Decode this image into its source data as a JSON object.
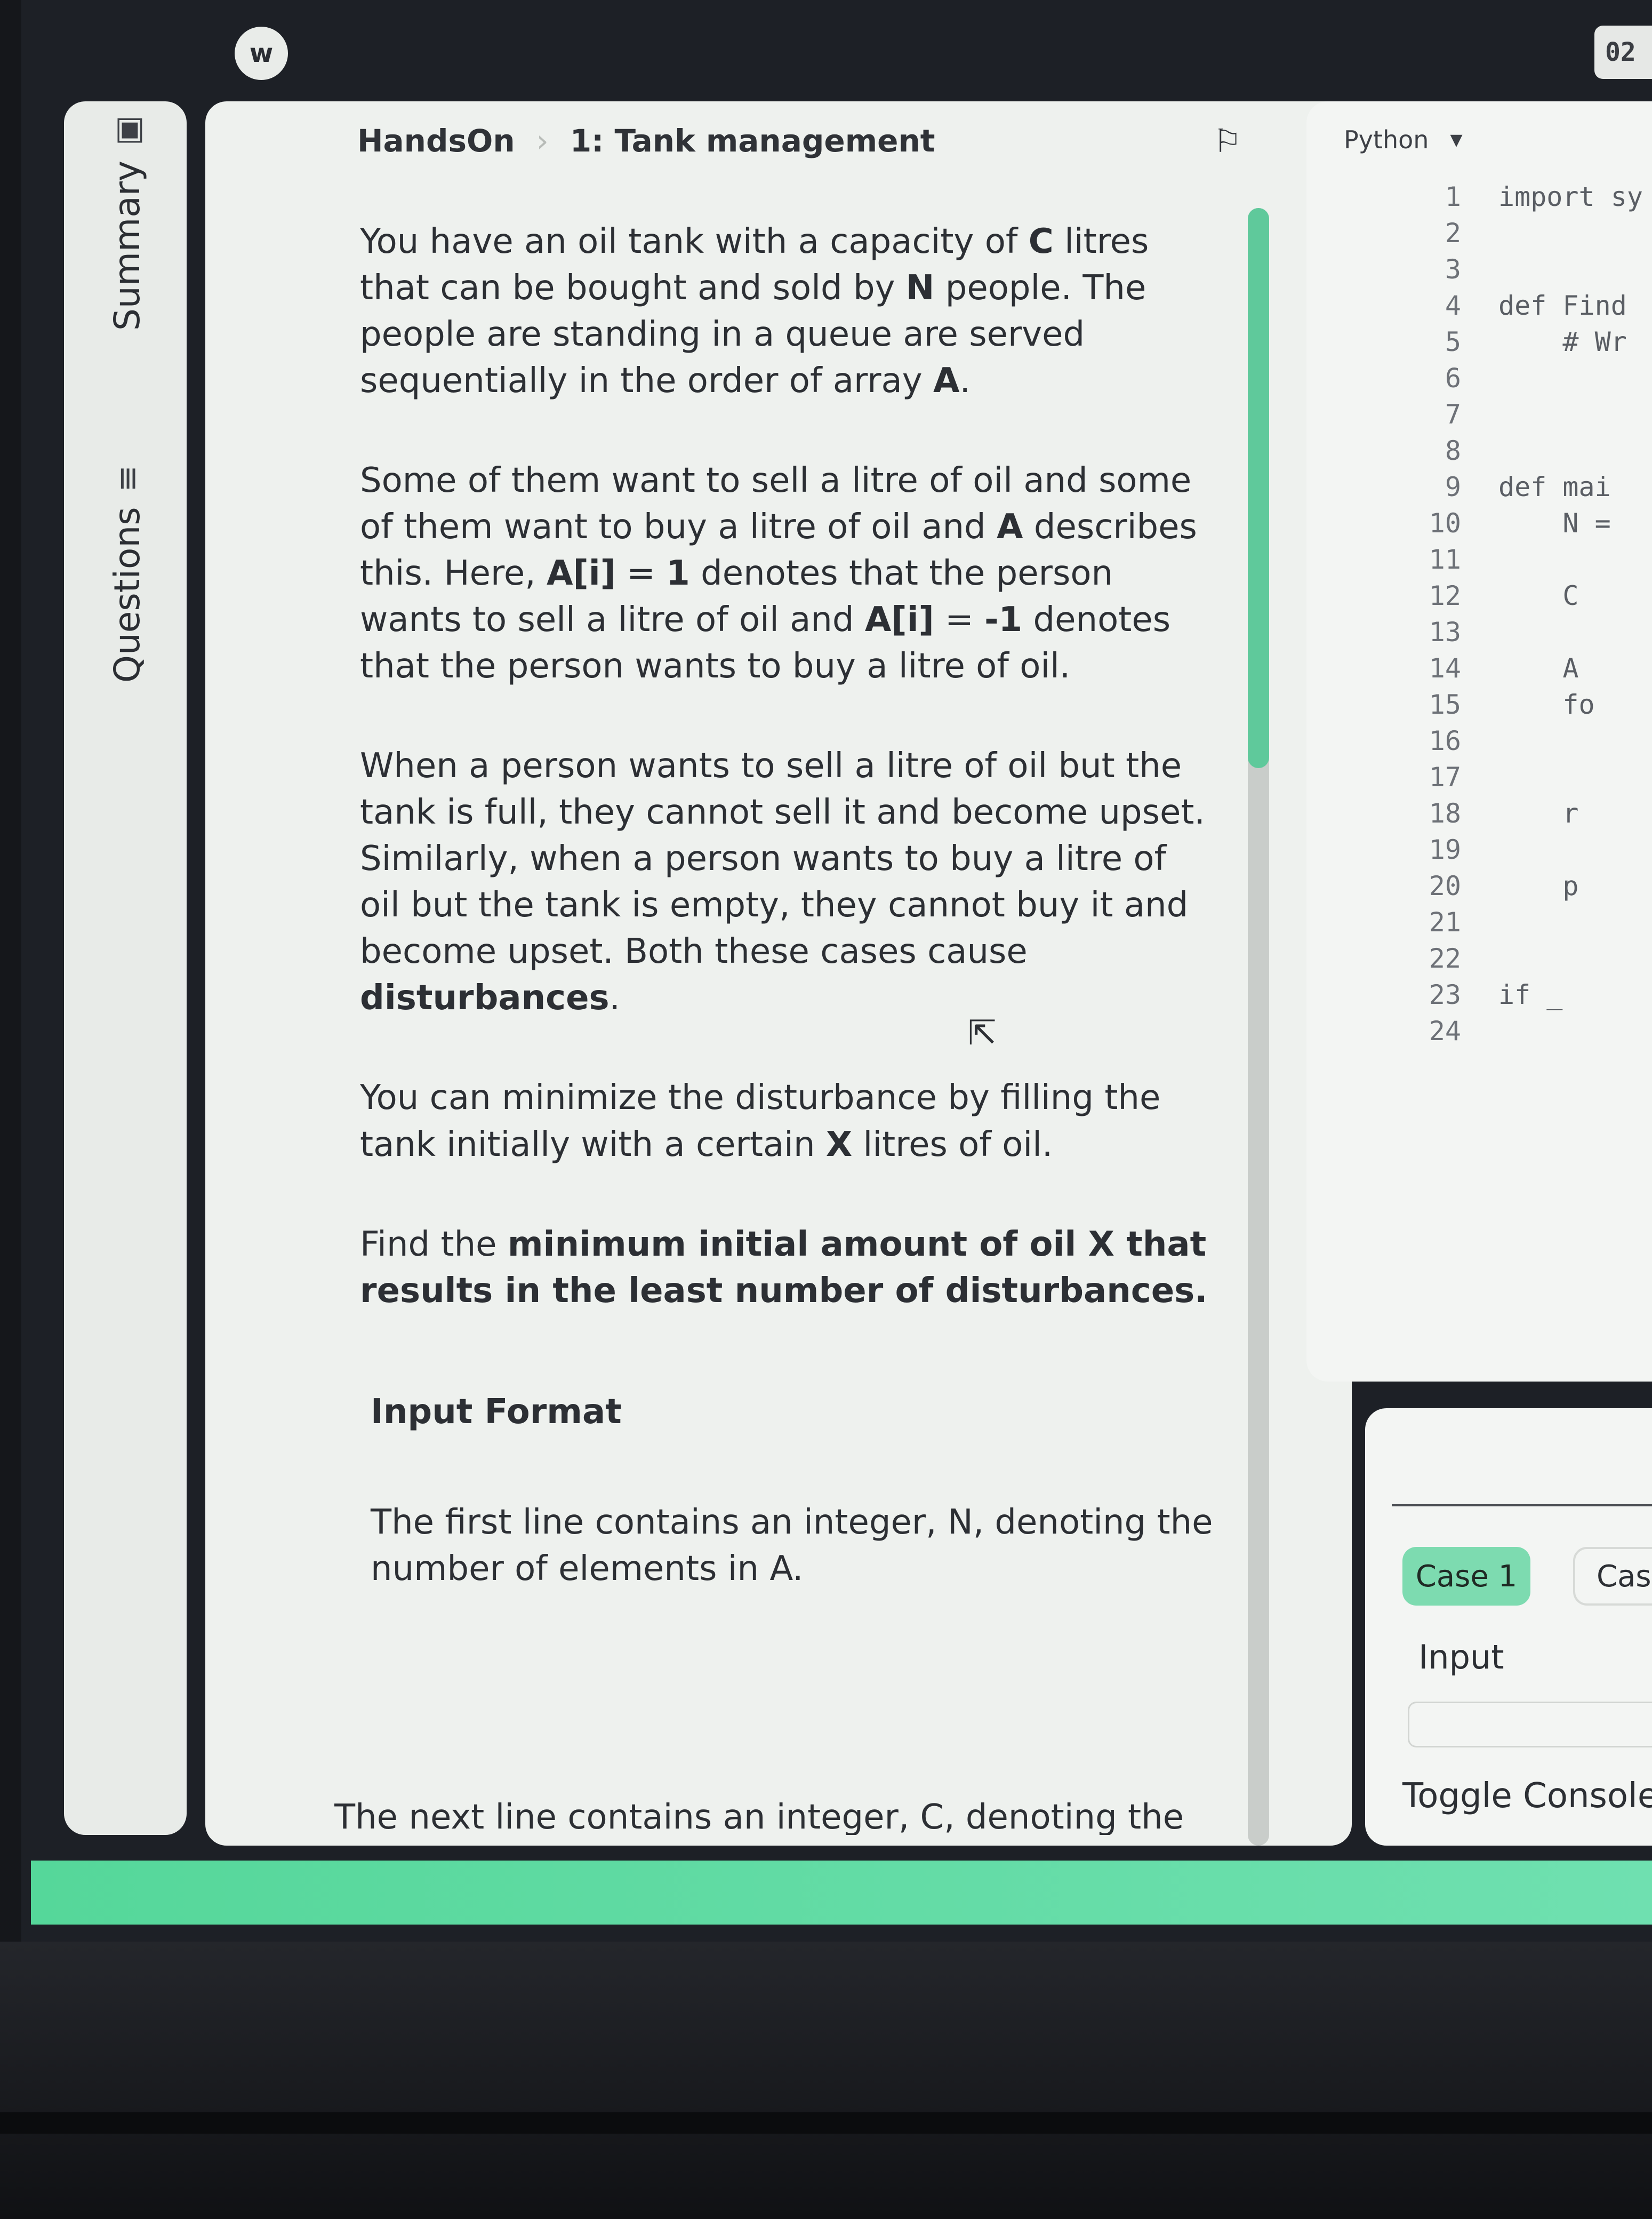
{
  "header": {
    "logo_glyph": "w",
    "timer": "02"
  },
  "sidebar": {
    "summary": {
      "label": "Summary",
      "icon": "bookmark-icon"
    },
    "questions": {
      "label": "Questions",
      "icon": "list-icon"
    }
  },
  "breadcrumb": {
    "root": "HandsOn",
    "current": "1: Tank management"
  },
  "question": {
    "p1_a": "You have an oil tank with a capacity of ",
    "p1_b": "C",
    "p1_c": " litres that can be bought and sold by ",
    "p1_d": "N",
    "p1_e": " people. The people are standing in a queue are served sequentially in the order of array ",
    "p1_f": "A",
    "p1_g": ".",
    "p2_a": "Some of them want to sell a litre of oil and some of them want to buy a litre of oil and ",
    "p2_b": "A",
    "p2_c": " describes this. Here, ",
    "p2_d": "A[i]",
    "p2_e": " = ",
    "p2_f": "1",
    "p2_g": " denotes that the person wants to sell a litre of oil and ",
    "p2_h": "A[i]",
    "p2_i": " = ",
    "p2_j": "-1",
    "p2_k": " denotes that the person wants to buy a litre of oil.",
    "p3_a": "When a person wants to sell a litre of oil but the tank is full, they cannot sell it and become upset. Similarly, when a person wants to buy a litre of oil but the tank is empty, they cannot buy it and become upset. Both these cases cause ",
    "p3_b": "disturbances",
    "p3_c": ".",
    "p4_a": "You can minimize the disturbance by filling the tank initially with a certain ",
    "p4_b": "X",
    "p4_c": " litres of oil.",
    "p5_a": "Find the ",
    "p5_b": "minimum initial amount of oil X that results in the least number of disturbances.",
    "input_heading": "Input Format",
    "input_line1": "The first line contains an integer, N, denoting the number of elements in A.",
    "input_line2_partial": "The next line contains an integer, C, denoting the"
  },
  "editor": {
    "language": "Python",
    "lines": [
      {
        "n": "1",
        "code": "import sy"
      },
      {
        "n": "2",
        "code": ""
      },
      {
        "n": "3",
        "code": ""
      },
      {
        "n": "4",
        "code": "def Find"
      },
      {
        "n": "5",
        "code": "    # Wr"
      },
      {
        "n": "6",
        "code": ""
      },
      {
        "n": "7",
        "code": ""
      },
      {
        "n": "8",
        "code": ""
      },
      {
        "n": "9",
        "code": "def mai"
      },
      {
        "n": "10",
        "code": "    N ="
      },
      {
        "n": "11",
        "code": ""
      },
      {
        "n": "12",
        "code": "    C"
      },
      {
        "n": "13",
        "code": ""
      },
      {
        "n": "14",
        "code": "    A"
      },
      {
        "n": "15",
        "code": "    fo"
      },
      {
        "n": "16",
        "code": ""
      },
      {
        "n": "17",
        "code": ""
      },
      {
        "n": "18",
        "code": "    r"
      },
      {
        "n": "19",
        "code": ""
      },
      {
        "n": "20",
        "code": "    p"
      },
      {
        "n": "21",
        "code": ""
      },
      {
        "n": "22",
        "code": ""
      },
      {
        "n": "23",
        "code": "if _"
      },
      {
        "n": "24",
        "code": ""
      }
    ]
  },
  "console": {
    "case1": "Case 1",
    "case2": "Case",
    "input_label": "Input",
    "toggle": "Toggle Console"
  }
}
